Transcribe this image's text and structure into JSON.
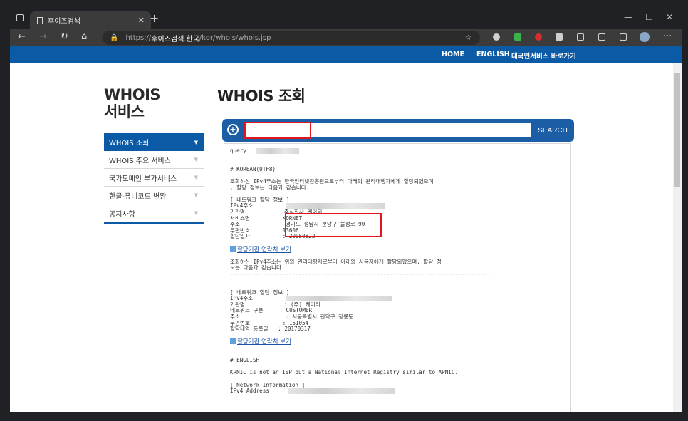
{
  "browser": {
    "tab_title": "후이즈검색",
    "url_prefix": "https://",
    "url_host": "후이즈검색.한국",
    "url_path": "/kor/whois/whois.jsp"
  },
  "site_nav": {
    "home": "HOME",
    "english": "ENGLISH",
    "gov": "대국민서비스 바로가기"
  },
  "sidebar": {
    "title_line1": "WHOIS",
    "title_line2": "서비스",
    "items": [
      {
        "label": "WHOIS 조회"
      },
      {
        "label": "WHOIS 주요 서비스"
      },
      {
        "label": "국가도메인 부가서비스"
      },
      {
        "label": "한글-퓨니코드 변환"
      },
      {
        "label": "공지사항"
      }
    ]
  },
  "main": {
    "title": "WHOIS 조회",
    "search_button": "SEARCH"
  },
  "result": {
    "query_label": "query :",
    "korean_header": "# KOREAN(UTF8)",
    "intro1a": "조회하신 IPv4주소는 한국인터넷진흥원으로부터 아래의 관리대행자에게 할당되었으며",
    "intro1b": ", 할당 정보는 다음과 같습니다.",
    "net_header": "[ 네트워크 할당 정보 ]",
    "row_ipv4": "IPv4주소",
    "row_org_label": "기관명",
    "row_org_value": "주식회사 케이티",
    "row_service_label": "서비스명",
    "row_service_value": "KORNET",
    "row_addr_label": "주소",
    "row_addr_value": "경기도 성남시 분당구 불정로 90",
    "row_zip_label": "우편번호",
    "row_zip_value": "13606",
    "row_date_label": "할당일자",
    "row_date_value": ": 20050822",
    "contact_link": "할당기관 연락처 보기",
    "intro2a": "조회하신 IPv4주소는 위의 관리대행자로부터 아래의 사용자에게 할당되었으며, 할당 정",
    "intro2b": "보는 다음과 같습니다.",
    "divider": "--------------------------------------------------------------------------------",
    "net2_header": "[ 네트워크 할당 정보 ]",
    "r2_ipv4": "IPv4주소",
    "r2_org_label": "기관명",
    "r2_org_value": ": (주) 케이티",
    "r2_type_label": "네트워크 구분",
    "r2_type_value": ": CUSTOMER",
    "r2_addr_label": "주소",
    "r2_addr_value": ": 서울특별시 관악구 청룡동",
    "r2_zip_label": "우편번호",
    "r2_zip_value": ": 151054",
    "r2_date_label": "할당내역 등록일",
    "r2_date_value": ": 20170317",
    "contact_link2": "할당기관 연락처 보기",
    "english_header": "# ENGLISH",
    "krnic_line": "KRNIC is not an ISP but a National Internet Registry similar to APNIC.",
    "net_info_header": "[ Network Information ]",
    "ipv4_address": "IPv4 Address"
  }
}
